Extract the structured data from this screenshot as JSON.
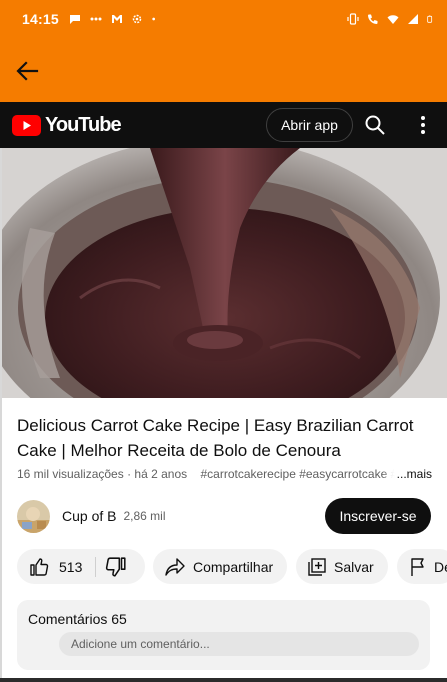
{
  "status_bar": {
    "time": "14:15",
    "left_icons": [
      "chat-bubble-icon",
      "dots-icon",
      "gmail-icon",
      "settings-gear-icon",
      "dot-icon"
    ],
    "right_icons": [
      "vibrate-icon",
      "call-icon",
      "wifi-icon",
      "signal-icon",
      "battery-icon"
    ]
  },
  "app_bar": {
    "back_icon": "arrow-back-icon",
    "color": "#f57c00"
  },
  "youtube_header": {
    "logo_text": "YouTube",
    "open_app_label": "Abrir app",
    "search_icon": "search-icon",
    "more_icon": "more-vertical-icon"
  },
  "video": {
    "title": "Delicious Carrot Cake Recipe | Easy Brazilian Carrot Cake | Melhor Receita de Bolo de Cenoura",
    "views": "16 mil visualizações",
    "age": "há 2 anos",
    "tags": "#carrotcakerecipe #easycarrotcake",
    "tags_faded": "#c",
    "more_label": "...mais"
  },
  "channel": {
    "name": "Cup of B",
    "subscribers": "2,86 mil",
    "subscribe_label": "Inscrever-se"
  },
  "actions": {
    "like_count": "513",
    "share_label": "Compartilhar",
    "save_label": "Salvar",
    "report_label": "De"
  },
  "comments": {
    "title": "Comentários 65",
    "placeholder": "Adicione um comentário..."
  },
  "colors": {
    "accent": "#f57c00",
    "youtube_red": "#ff0000",
    "header_bg": "#0f0f0f",
    "chip_bg": "#f2f2f2"
  }
}
